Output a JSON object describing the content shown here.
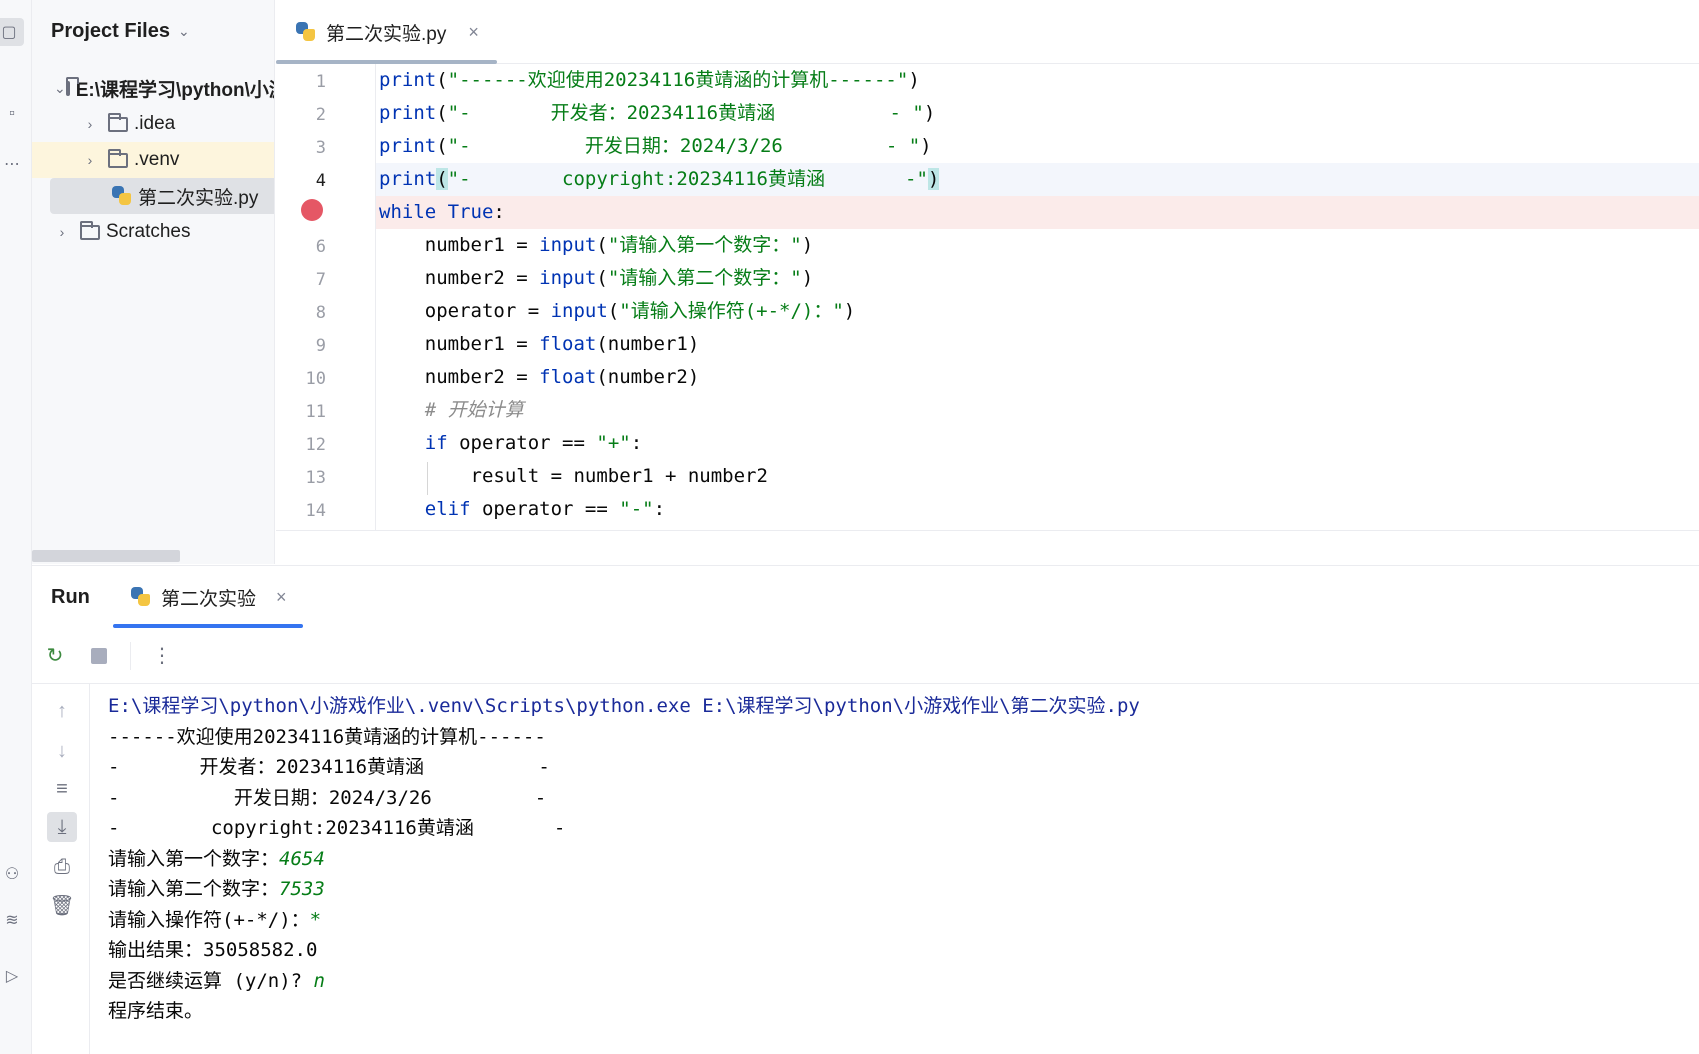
{
  "project_panel": {
    "title": "Project Files",
    "tree": [
      {
        "label": "E:\\课程学习\\python\\小游戏作业",
        "type": "folder",
        "expanded": true
      },
      {
        "label": ".idea",
        "type": "folder",
        "expanded": false
      },
      {
        "label": ".venv",
        "type": "folder",
        "expanded": false
      },
      {
        "label": "第二次实验.py",
        "type": "python-file"
      },
      {
        "label": "Scratches",
        "type": "folder",
        "expanded": false
      }
    ]
  },
  "editor": {
    "tab_label": "第二次实验.py",
    "current_line": 4,
    "breakpoint_line": 5,
    "line_numbers": [
      "1",
      "2",
      "3",
      "4",
      "",
      "6",
      "7",
      "8",
      "9",
      "10",
      "11",
      "12",
      "13",
      "14"
    ],
    "code": [
      {
        "t1": "print",
        "t2": "(",
        "t3": "\"------欢迎使用20234116黄靖涵的计算机------\"",
        "t4": ")"
      },
      {
        "t1": "print",
        "t2": "(",
        "t3": "\"-       开发者：20234116黄靖涵          - \"",
        "t4": ")"
      },
      {
        "t1": "print",
        "t2": "(",
        "t3": "\"-          开发日期：2024/3/26         - \"",
        "t4": ")"
      },
      {
        "t1": "print",
        "t2": "(",
        "t3": "\"-        copyright:20234116黄靖涵       -\"",
        "t4": ")"
      },
      {
        "t1": "while True",
        "t2": ":"
      },
      {
        "t1": "    number1 = ",
        "t2": "input",
        "t3": "(",
        "t4": "\"请输入第一个数字：\"",
        "t5": ")"
      },
      {
        "t1": "    number2 = ",
        "t2": "input",
        "t3": "(",
        "t4": "\"请输入第二个数字：\"",
        "t5": ")"
      },
      {
        "t1": "    operator = ",
        "t2": "input",
        "t3": "(",
        "t4": "\"请输入操作符(+-*/)：\"",
        "t5": ")"
      },
      {
        "t1": "    number1 = ",
        "t2": "float",
        "t3": "(number1)"
      },
      {
        "t1": "    number2 = ",
        "t2": "float",
        "t3": "(number2)"
      },
      {
        "t1": "    # 开始计算"
      },
      {
        "t1": "    ",
        "t2": "if",
        "t3": " operator == ",
        "t4": "\"+\"",
        "t5": ":"
      },
      {
        "t1": "        result = number1 + number2"
      },
      {
        "t1": "    ",
        "t2": "elif",
        "t3": " operator == ",
        "t4": "\"-\"",
        "t5": ":"
      }
    ]
  },
  "run_panel": {
    "title": "Run",
    "tab_label": "第二次实验",
    "output": [
      {
        "text": "E:\\课程学习\\python\\小游戏作业\\.venv\\Scripts\\python.exe E:\\课程学习\\python\\小游戏作业\\第二次实验.py"
      },
      {
        "text": "------欢迎使用20234116黄靖涵的计算机------"
      },
      {
        "text": "-       开发者：20234116黄靖涵          -"
      },
      {
        "text": "-          开发日期：2024/3/26         -"
      },
      {
        "text": "-        copyright:20234116黄靖涵       -"
      },
      {
        "text": "请输入第一个数字：",
        "input": "4654"
      },
      {
        "text": "请输入第二个数字：",
        "input": "7533"
      },
      {
        "text": "请输入操作符(+-*/)：",
        "input": "*"
      },
      {
        "text": "输出结果：35058582.0"
      },
      {
        "text": "是否继续运算 (y/n)? ",
        "input": "n"
      },
      {
        "text": "程序结束。"
      }
    ]
  },
  "icons": {
    "rerun": "↻",
    "more": "⋮",
    "up": "↑",
    "down": "↓",
    "wrap": "≡",
    "scroll_end": "⤓",
    "print": "⎙",
    "trash": "🗑",
    "chevron_down": "⌄",
    "chevron_right": "›",
    "close": "×"
  },
  "colors": {
    "keyword": "#0033b3",
    "string": "#067d17",
    "comment": "#8c8c8c",
    "breakpoint": "#e55765",
    "run_tab_underline": "#3574f0"
  }
}
